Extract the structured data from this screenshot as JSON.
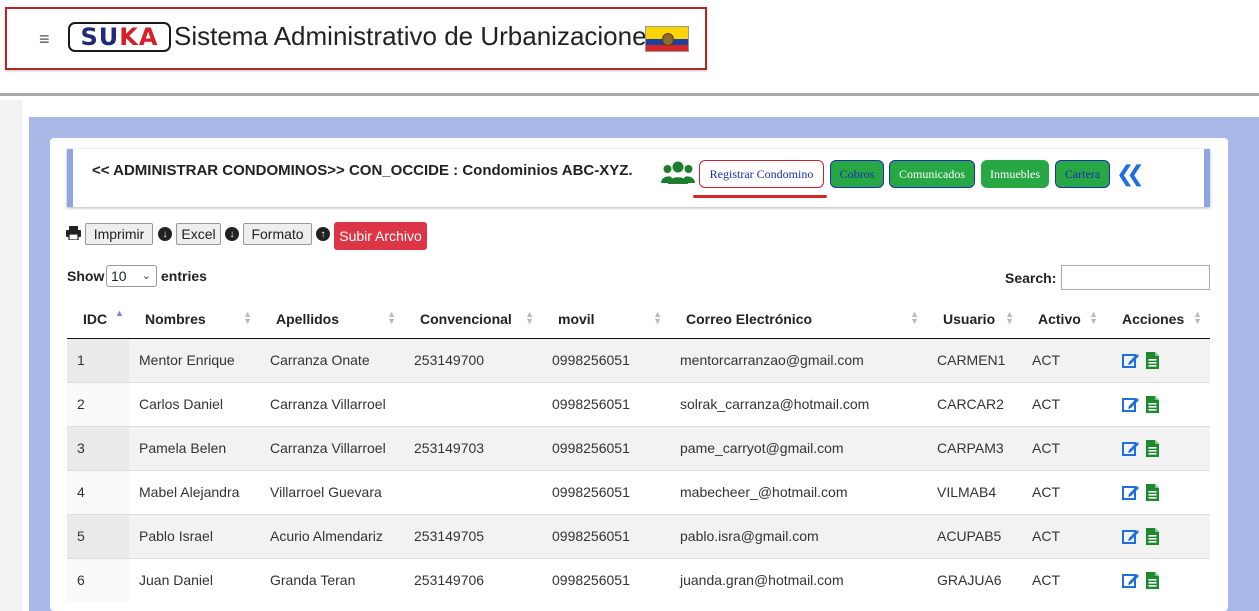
{
  "header": {
    "menu_icon": "hamburger-icon",
    "logo_letters": [
      "S",
      "U",
      "K",
      "A"
    ],
    "title": "Sistema Administrativo de Urbanizaciones",
    "flag": "ecuador-flag"
  },
  "panel": {
    "title": "<< ADMINISTRAR CONDOMINOS>> CON_OCCIDE : Condominios ABC-XYZ.",
    "users_icon": "users-icon",
    "buttons": {
      "registrar": "Registrar Condomino",
      "cobros": "Cobros",
      "comunicados": "Comunicados",
      "inmuebles": "Inmuebles",
      "cartera": "Cartera"
    },
    "back_icon": "double-chevron-left-icon"
  },
  "toolbar": {
    "imprimir": "Imprimir",
    "excel": "Excel",
    "formato": "Formato",
    "subir": "Subir Archivo"
  },
  "table_controls": {
    "show_label": "Show",
    "show_value": "10",
    "entries_label": "entries",
    "search_label": "Search:",
    "search_value": ""
  },
  "table": {
    "columns": [
      "IDC",
      "Nombres",
      "Apellidos",
      "Convencional",
      "movil",
      "Correo Electrónico",
      "Usuario",
      "Activo",
      "Acciones"
    ],
    "rows": [
      {
        "idc": "1",
        "nombres": "Mentor Enrique",
        "apellidos": "Carranza Onate",
        "convencional": "253149700",
        "movil": "0998256051",
        "correo": "mentorcarranzao@gmail.com",
        "usuario": "CARMEN1",
        "activo": "ACT"
      },
      {
        "idc": "2",
        "nombres": "Carlos Daniel",
        "apellidos": "Carranza Villarroel",
        "convencional": "",
        "movil": "0998256051",
        "correo": "solrak_carranza@hotmail.com",
        "usuario": "CARCAR2",
        "activo": "ACT"
      },
      {
        "idc": "3",
        "nombres": "Pamela Belen",
        "apellidos": "Carranza Villarroel",
        "convencional": "253149703",
        "movil": "0998256051",
        "correo": "pame_carryot@gmail.com",
        "usuario": "CARPAM3",
        "activo": "ACT"
      },
      {
        "idc": "4",
        "nombres": "Mabel Alejandra",
        "apellidos": "Villarroel Guevara",
        "convencional": "",
        "movil": "0998256051",
        "correo": "mabecheer_@hotmail.com",
        "usuario": "VILMAB4",
        "activo": "ACT"
      },
      {
        "idc": "5",
        "nombres": "Pablo Israel",
        "apellidos": "Acurio Almendariz",
        "convencional": "253149705",
        "movil": "0998256051",
        "correo": "pablo.isra@gmail.com",
        "usuario": "ACUPAB5",
        "activo": "ACT"
      },
      {
        "idc": "6",
        "nombres": "Juan Daniel",
        "apellidos": "Granda Teran",
        "convencional": "253149706",
        "movil": "0998256051",
        "correo": "juanda.gran@hotmail.com",
        "usuario": "GRAJUA6",
        "activo": "ACT"
      }
    ]
  },
  "colors": {
    "accent_red": "#dc3545",
    "green": "#28a745",
    "link_blue": "#1f6fe0",
    "panel_bg": "#aab8e8"
  }
}
